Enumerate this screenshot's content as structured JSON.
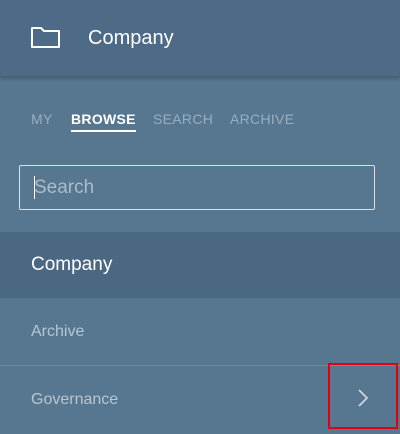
{
  "header": {
    "title": "Company",
    "icon": "folder-icon"
  },
  "tabs": [
    {
      "label": "MY",
      "active": false
    },
    {
      "label": "BROWSE",
      "active": true
    },
    {
      "label": "SEARCH",
      "active": false
    },
    {
      "label": "ARCHIVE",
      "active": false
    }
  ],
  "search": {
    "placeholder": "Search",
    "value": ""
  },
  "nav": {
    "current": {
      "label": "Company"
    },
    "items": [
      {
        "label": "Archive",
        "has_children": false
      },
      {
        "label": "Governance",
        "has_children": true,
        "icon": "chevron-right-icon"
      }
    ]
  },
  "colors": {
    "header_bg": "#4d6b86",
    "panel_bg": "#57768f",
    "current_bg": "#4b6882",
    "highlight_border": "#e0000e"
  }
}
